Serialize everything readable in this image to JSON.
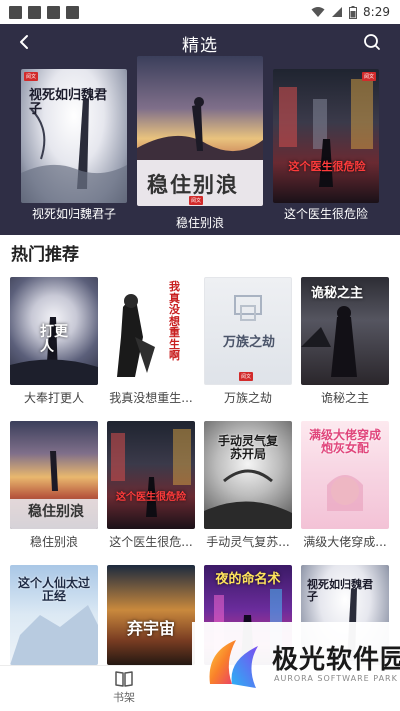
{
  "status_bar": {
    "time": "8:29",
    "icons": [
      "notification-square-icon",
      "notification-square-icon",
      "notification-square-icon",
      "notification-square-icon",
      "wifi-icon",
      "signal-icon",
      "battery-icon"
    ]
  },
  "header": {
    "title": "精选",
    "back_icon": "back-arrow-icon",
    "search_icon": "search-icon",
    "background": "#2f2e45"
  },
  "hero_books": [
    {
      "title": "视死如归魏君子",
      "cover_text": "视死如归魏君子"
    },
    {
      "title": "稳住别浪",
      "cover_text": "稳住别浪"
    },
    {
      "title": "这个医生很危险",
      "cover_text": "这个医生很危险"
    }
  ],
  "section": {
    "title": "热门推荐"
  },
  "grid_books": [
    {
      "title": "大奉打更人",
      "cover_text": "打更人"
    },
    {
      "title": "我真没想重生...",
      "cover_text": "我真没想重生啊"
    },
    {
      "title": "万族之劫",
      "cover_text": "万族之劫"
    },
    {
      "title": "诡秘之主",
      "cover_text": "诡秘之主"
    },
    {
      "title": "稳住别浪",
      "cover_text": "稳住别浪"
    },
    {
      "title": "这个医生很危...",
      "cover_text": "这个医生很危险"
    },
    {
      "title": "手动灵气复苏...",
      "cover_text": "手动灵气复苏开局"
    },
    {
      "title": "满级大佬穿成...",
      "cover_text": "满级大佬穿成炮灰女配"
    },
    {
      "title": "",
      "cover_text": "这个人仙太过正经"
    },
    {
      "title": "",
      "cover_text": "弃宇宙"
    },
    {
      "title": "",
      "cover_text": "夜的命名术"
    },
    {
      "title": "",
      "cover_text": "视死如归魏君子"
    }
  ],
  "bottom_nav": {
    "bookshelf_label": "书架",
    "bookshelf_icon": "book-open-icon"
  },
  "watermark": {
    "title": "极光软件园",
    "subtitle": "AURORA SOFTWARE PARK"
  }
}
